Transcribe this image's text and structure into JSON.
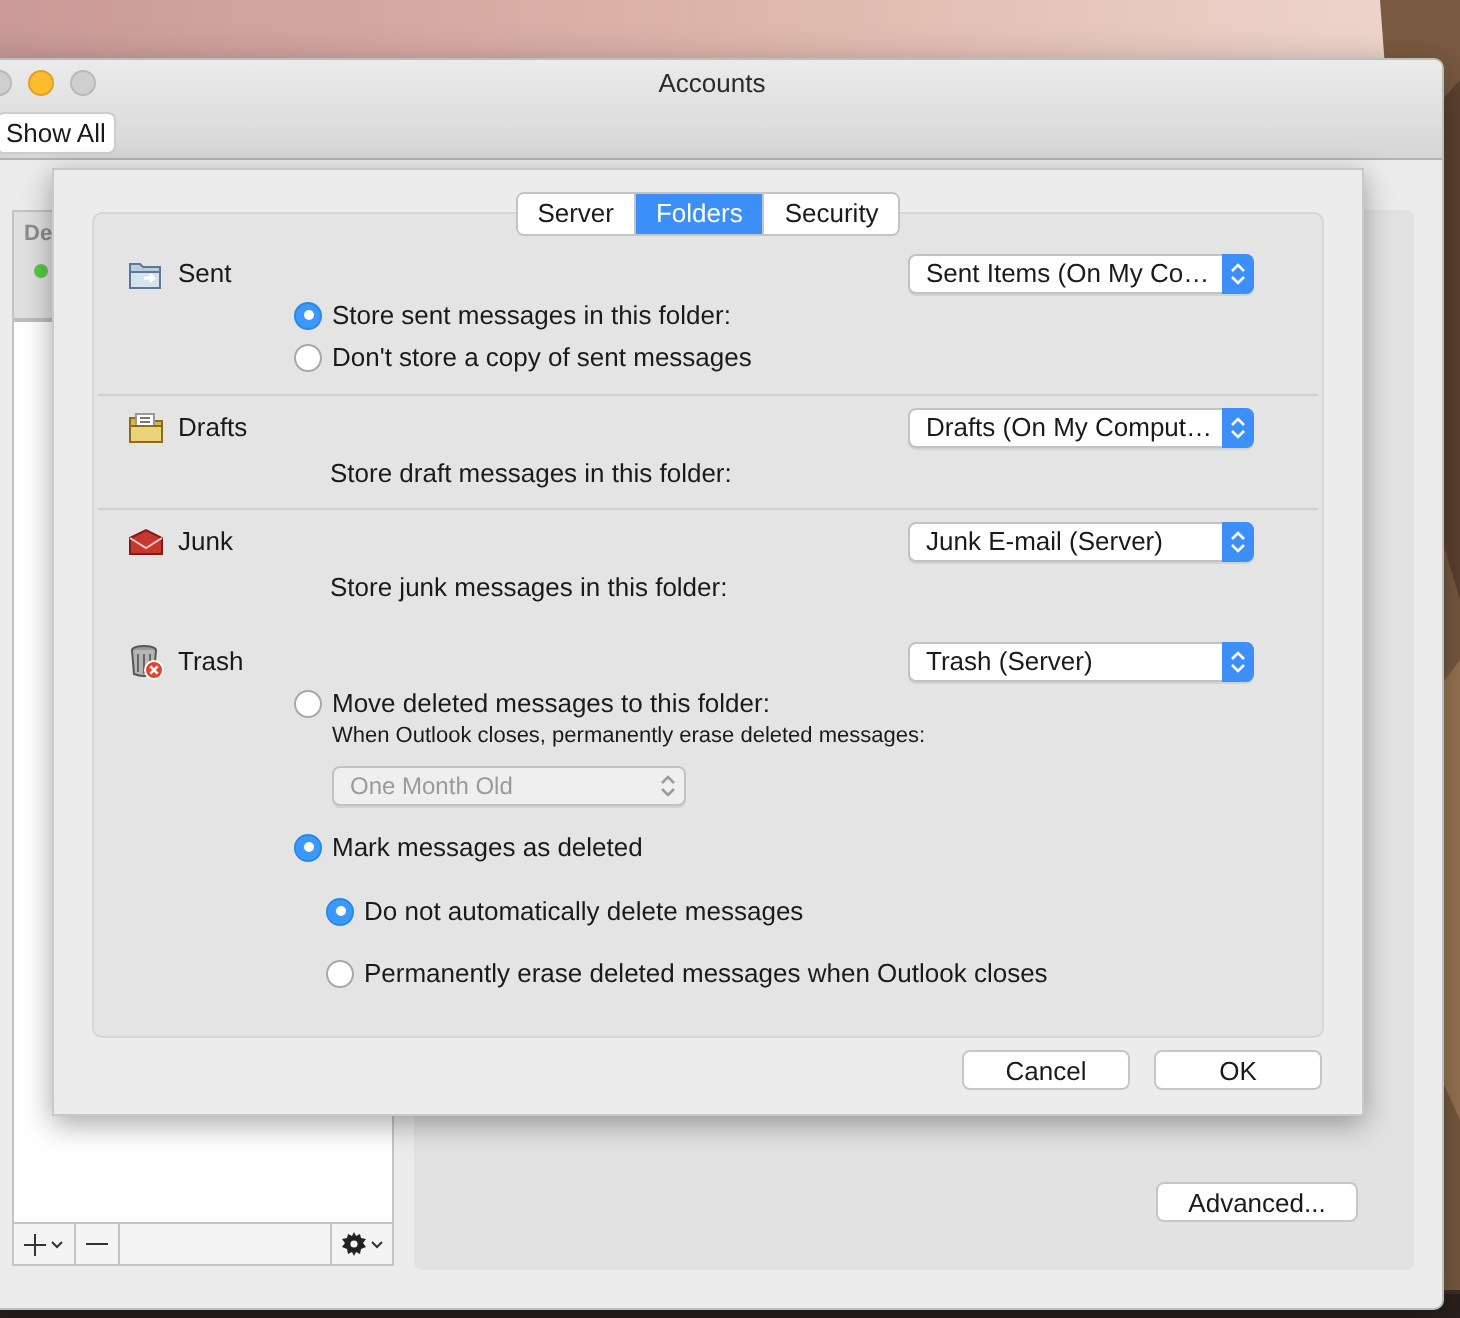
{
  "window": {
    "title": "Accounts"
  },
  "toolbar": {
    "show_all": "Show All"
  },
  "account_list": {
    "header": "De"
  },
  "advanced_button": "Advanced...",
  "sheet": {
    "tabs": [
      {
        "label": "Server",
        "selected": false
      },
      {
        "label": "Folders",
        "selected": true
      },
      {
        "label": "Security",
        "selected": false
      }
    ],
    "folders": [
      {
        "kind": "sent",
        "name": "Sent",
        "folder": "Sent Items (On My Co…",
        "divider": true,
        "options": [
          {
            "label": "Store sent messages in this folder:",
            "selected": true
          },
          {
            "label": "Don't store a copy of sent messages",
            "selected": false
          }
        ]
      },
      {
        "kind": "drafts",
        "name": "Drafts",
        "folder": "Drafts (On My Comput…",
        "divider": true,
        "note": "Store draft messages in this folder:"
      },
      {
        "kind": "junk",
        "name": "Junk",
        "folder": "Junk E-mail (Server)",
        "divider": false,
        "note": "Store junk messages in this folder:"
      },
      {
        "kind": "trash",
        "name": "Trash",
        "folder": "Trash (Server)",
        "divider": false,
        "options": [
          {
            "label": "Move deleted messages to this folder:",
            "selected": false,
            "note": "When Outlook closes, permanently erase deleted messages:",
            "select": {
              "value": "One Month Old",
              "disabled": true
            }
          },
          {
            "label": "Mark messages as deleted",
            "selected": true,
            "children": [
              {
                "label": "Do not automatically delete messages",
                "selected": true
              },
              {
                "label": "Permanently erase deleted messages when Outlook closes",
                "selected": false
              }
            ]
          }
        ]
      }
    ],
    "buttons": [
      "Cancel",
      "OK"
    ]
  }
}
